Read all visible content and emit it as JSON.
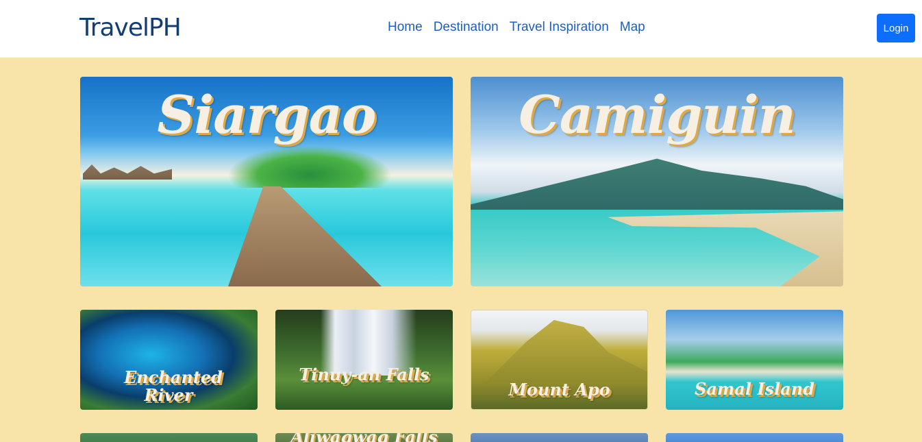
{
  "nav": {
    "brand": "TravelPH",
    "links": [
      "Home",
      "Destination",
      "Travel Inspiration",
      "Map"
    ],
    "login": "Login"
  },
  "featured": [
    {
      "title": "Siargao"
    },
    {
      "title": "Camiguin"
    }
  ],
  "cards": [
    {
      "title": "Enchanted River"
    },
    {
      "title": "Tinuy-an Falls"
    },
    {
      "title": "Mount Apo"
    },
    {
      "title": "Samal Island"
    }
  ],
  "next_row_peek": {
    "title": "Aliwagwag Falls"
  }
}
